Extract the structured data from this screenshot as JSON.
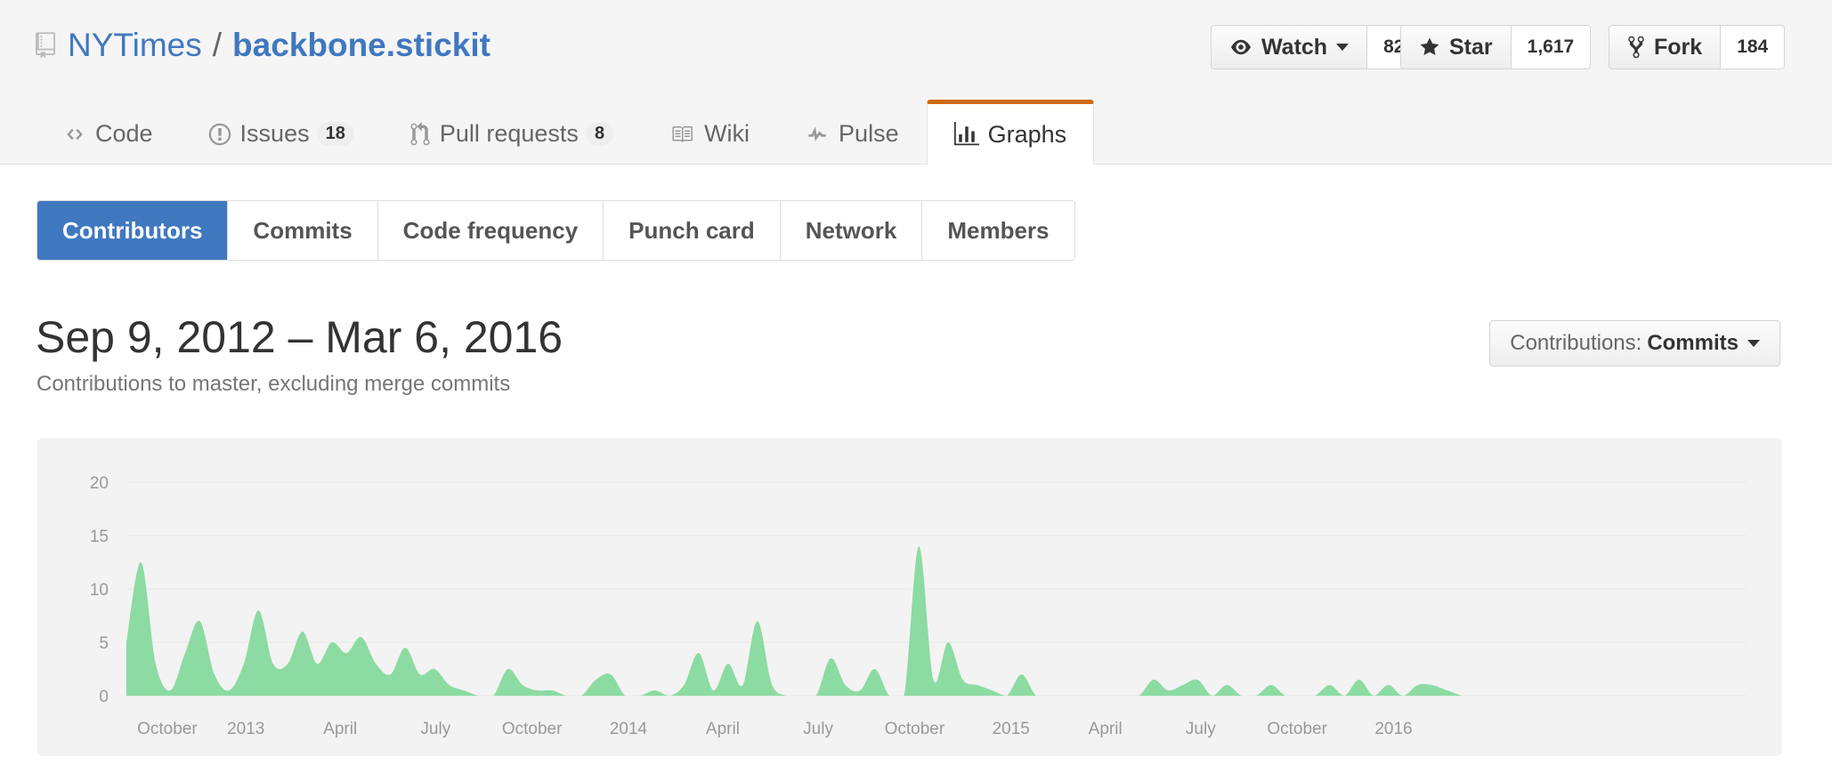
{
  "repo": {
    "owner": "NYTimes",
    "separator": "/",
    "name": "backbone.stickit"
  },
  "actions": {
    "watch": {
      "label": "Watch",
      "count": "82"
    },
    "star": {
      "label": "Star",
      "count": "1,617"
    },
    "fork": {
      "label": "Fork",
      "count": "184"
    }
  },
  "nav": {
    "code": "Code",
    "issues": {
      "label": "Issues",
      "count": "18"
    },
    "pulls": {
      "label": "Pull requests",
      "count": "8"
    },
    "wiki": "Wiki",
    "pulse": "Pulse",
    "graphs": "Graphs"
  },
  "subnav": {
    "contributors": "Contributors",
    "commits": "Commits",
    "code_frequency": "Code frequency",
    "punch_card": "Punch card",
    "network": "Network",
    "members": "Members"
  },
  "date_range": "Sep 9, 2012 – Mar 6, 2016",
  "date_subtitle": "Contributions to master, excluding merge commits",
  "contributions_select": {
    "prefix": "Contributions:",
    "value": "Commits"
  },
  "colors": {
    "accent": "#4078c0",
    "tab_highlight": "#d26911",
    "area_fill": "#8cdba2"
  },
  "chart_data": {
    "type": "area",
    "xlabel": "",
    "ylabel": "",
    "ylim": [
      0,
      20
    ],
    "yticks": [
      "20",
      "15",
      "10",
      "5",
      "0"
    ],
    "xticks": [
      "October",
      "2013",
      "April",
      "July",
      "October",
      "2014",
      "April",
      "July",
      "October",
      "2015",
      "April",
      "July",
      "October",
      "2016"
    ],
    "grid": true,
    "x": [
      "2012-09-09",
      "2012-09-23",
      "2012-10-07",
      "2012-10-21",
      "2012-11-04",
      "2012-11-18",
      "2012-12-02",
      "2012-12-16",
      "2012-12-30",
      "2013-01-13",
      "2013-01-27",
      "2013-02-10",
      "2013-02-24",
      "2013-03-10",
      "2013-03-24",
      "2013-04-07",
      "2013-04-21",
      "2013-05-05",
      "2013-05-19",
      "2013-06-02",
      "2013-06-16",
      "2013-06-30",
      "2013-07-14",
      "2013-07-28",
      "2013-08-11",
      "2013-08-25",
      "2013-09-08",
      "2013-09-22",
      "2013-10-06",
      "2013-10-20",
      "2013-11-03",
      "2013-11-17",
      "2013-12-01",
      "2013-12-15",
      "2013-12-29",
      "2014-01-12",
      "2014-01-26",
      "2014-02-09",
      "2014-02-23",
      "2014-03-09",
      "2014-03-23",
      "2014-04-06",
      "2014-04-20",
      "2014-05-04",
      "2014-05-18",
      "2014-06-01",
      "2014-06-15",
      "2014-06-29",
      "2014-07-13",
      "2014-07-27",
      "2014-08-10",
      "2014-08-24",
      "2014-09-07",
      "2014-09-21",
      "2014-10-05",
      "2014-10-19",
      "2014-11-02",
      "2014-11-16",
      "2014-11-30",
      "2014-12-14",
      "2014-12-28",
      "2015-01-11",
      "2015-01-25",
      "2015-02-08",
      "2015-02-22",
      "2015-03-08",
      "2015-03-22",
      "2015-04-05",
      "2015-04-19",
      "2015-05-03",
      "2015-05-17",
      "2015-05-31",
      "2015-06-14",
      "2015-06-28",
      "2015-07-12",
      "2015-07-26",
      "2015-08-09",
      "2015-08-23",
      "2015-09-06",
      "2015-09-20",
      "2015-10-04",
      "2015-10-18",
      "2015-11-01",
      "2015-11-15",
      "2015-11-29",
      "2015-12-13",
      "2015-12-27",
      "2016-01-10",
      "2016-01-24",
      "2016-02-07",
      "2016-02-21",
      "2016-03-06"
    ],
    "series": [
      {
        "values": [
          5,
          12.5,
          3,
          0.5,
          4,
          7,
          2,
          0.5,
          3,
          8,
          3,
          3,
          6,
          3,
          5,
          4,
          5.5,
          3,
          2,
          4.5,
          2,
          2.5,
          1,
          0.5,
          0,
          0,
          2.5,
          1,
          0.5,
          0.5,
          0,
          0,
          1.5,
          2,
          0,
          0,
          0.5,
          0,
          1,
          4,
          0.5,
          3,
          1,
          7,
          1,
          0,
          0,
          0,
          3.5,
          1,
          0.5,
          2.5,
          0,
          0,
          14,
          1.5,
          5,
          1.5,
          1,
          0.5,
          0,
          2,
          0,
          0,
          0,
          0,
          0,
          0,
          0,
          0,
          1.5,
          0.5,
          1,
          1.5,
          0,
          1,
          0,
          0,
          1,
          0,
          0,
          0,
          1,
          0,
          1.5,
          0,
          1,
          0,
          1,
          1,
          0.5,
          0
        ]
      }
    ]
  }
}
